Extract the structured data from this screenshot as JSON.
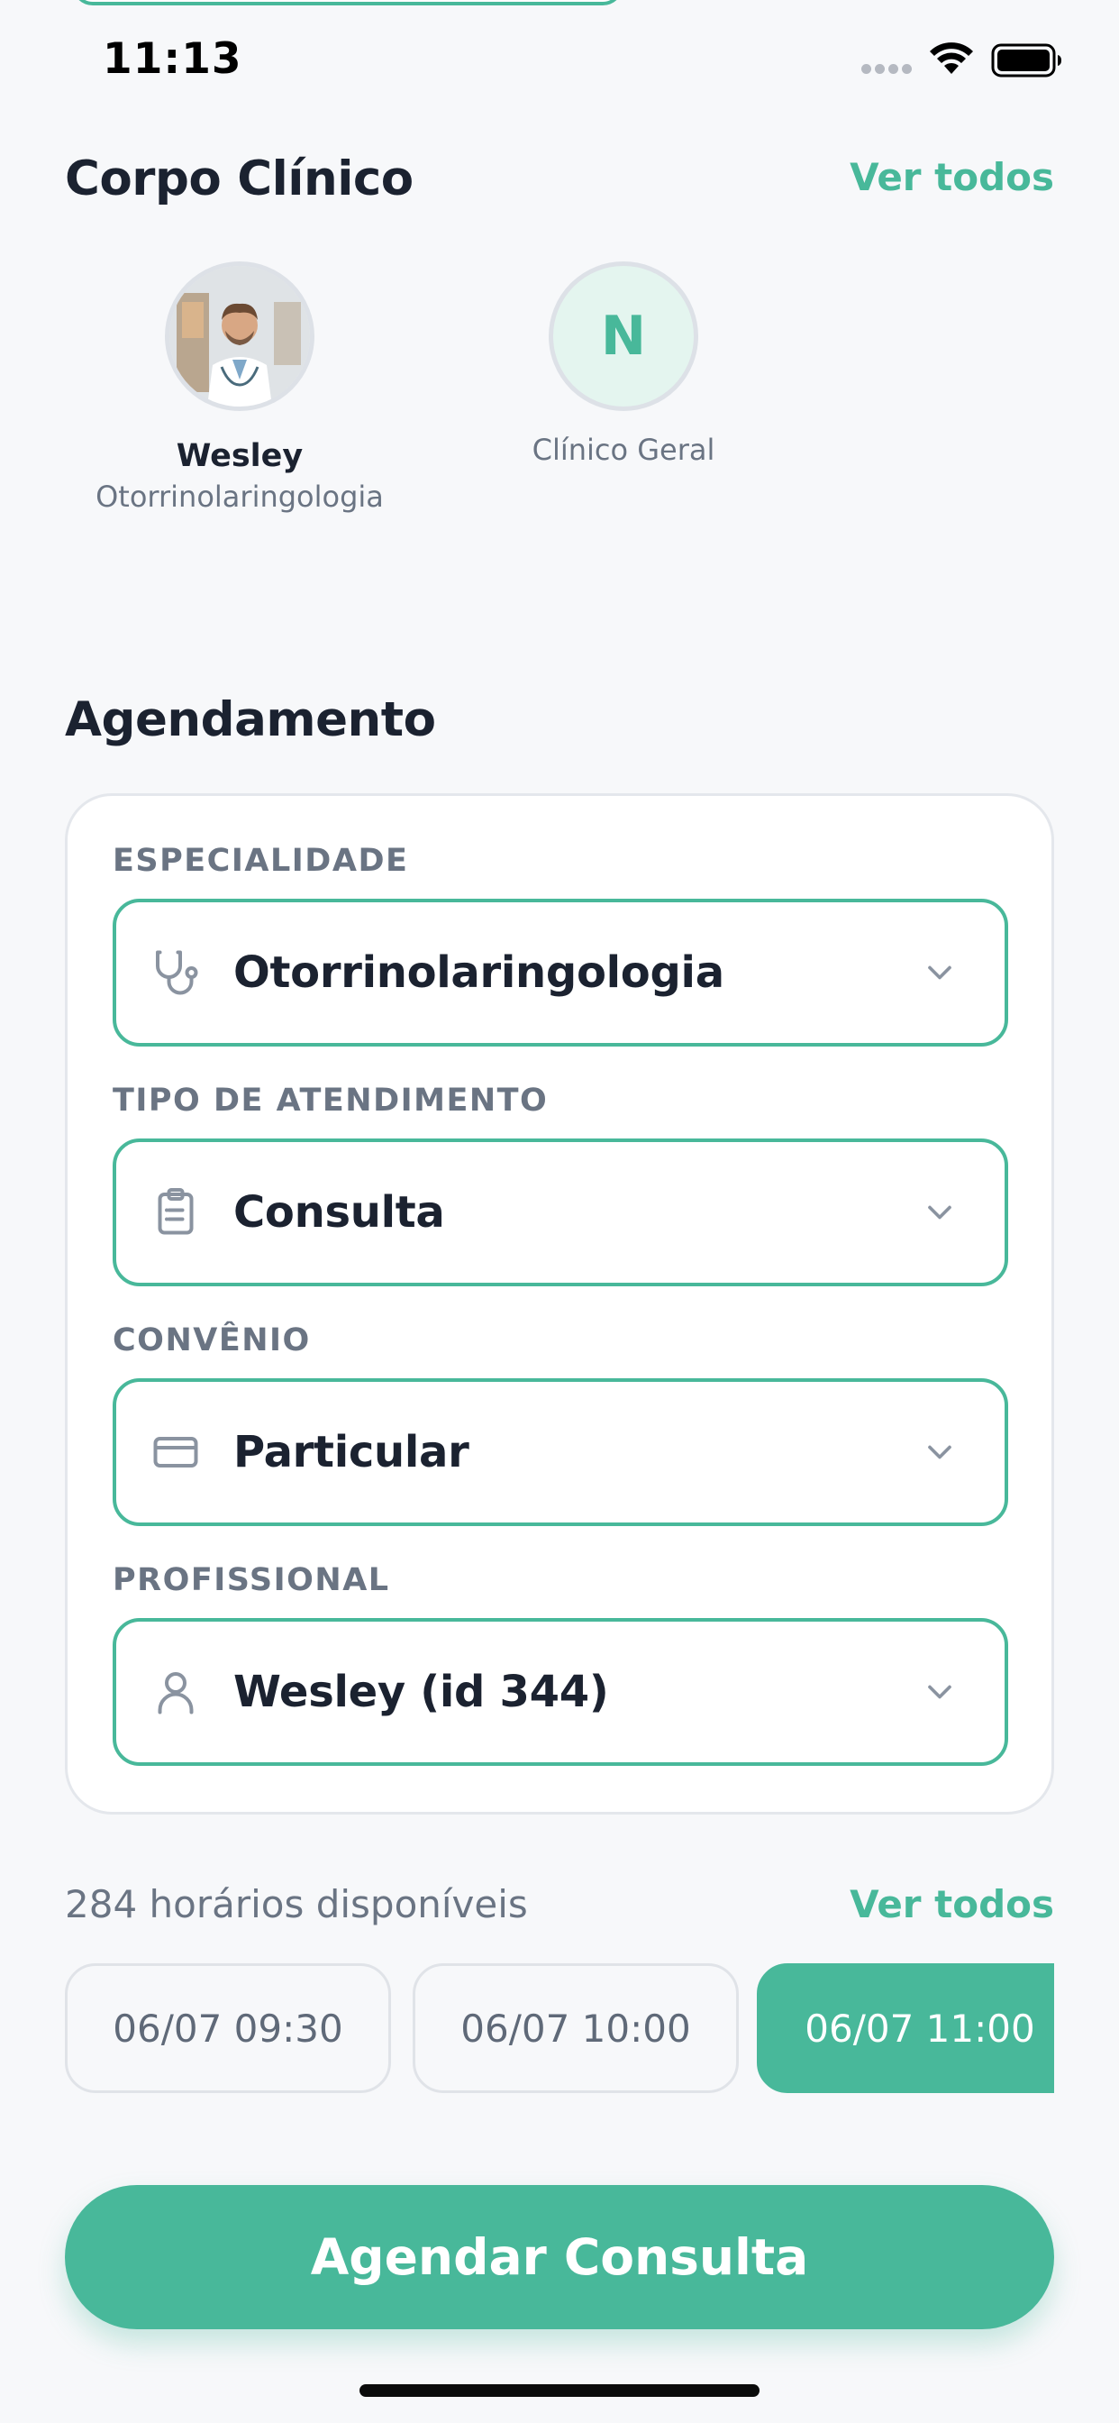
{
  "status_bar": {
    "time": "11:13"
  },
  "team": {
    "title": "Corpo Clínico",
    "see_all": "Ver todos",
    "members": [
      {
        "name": "Wesley",
        "specialty": "Otorrinolaringologia",
        "avatar": "doctor-photo"
      },
      {
        "initial": "N",
        "specialty": "Clínico Geral"
      }
    ]
  },
  "booking": {
    "title": "Agendamento",
    "fields": [
      {
        "label": "ESPECIALIDADE",
        "value": "Otorrinolaringologia",
        "icon": "stethoscope-icon"
      },
      {
        "label": "TIPO DE ATENDIMENTO",
        "value": "Consulta",
        "icon": "clipboard-icon"
      },
      {
        "label": "CONVÊNIO",
        "value": "Particular",
        "icon": "credit-card-icon"
      },
      {
        "label": "PROFISSIONAL",
        "value": "Wesley (id 344)",
        "icon": "user-icon"
      }
    ]
  },
  "slots": {
    "count_text": "284 horários disponíveis",
    "see_all": "Ver todos",
    "items": [
      "06/07 09:30",
      "06/07 10:00",
      "06/07 11:00"
    ],
    "selected_index": 2
  },
  "cta": {
    "label": "Agendar Consulta"
  },
  "colors": {
    "accent": "#48b89a",
    "text": "#1b2230",
    "muted": "#6a7483",
    "background": "#f7f8fa"
  }
}
